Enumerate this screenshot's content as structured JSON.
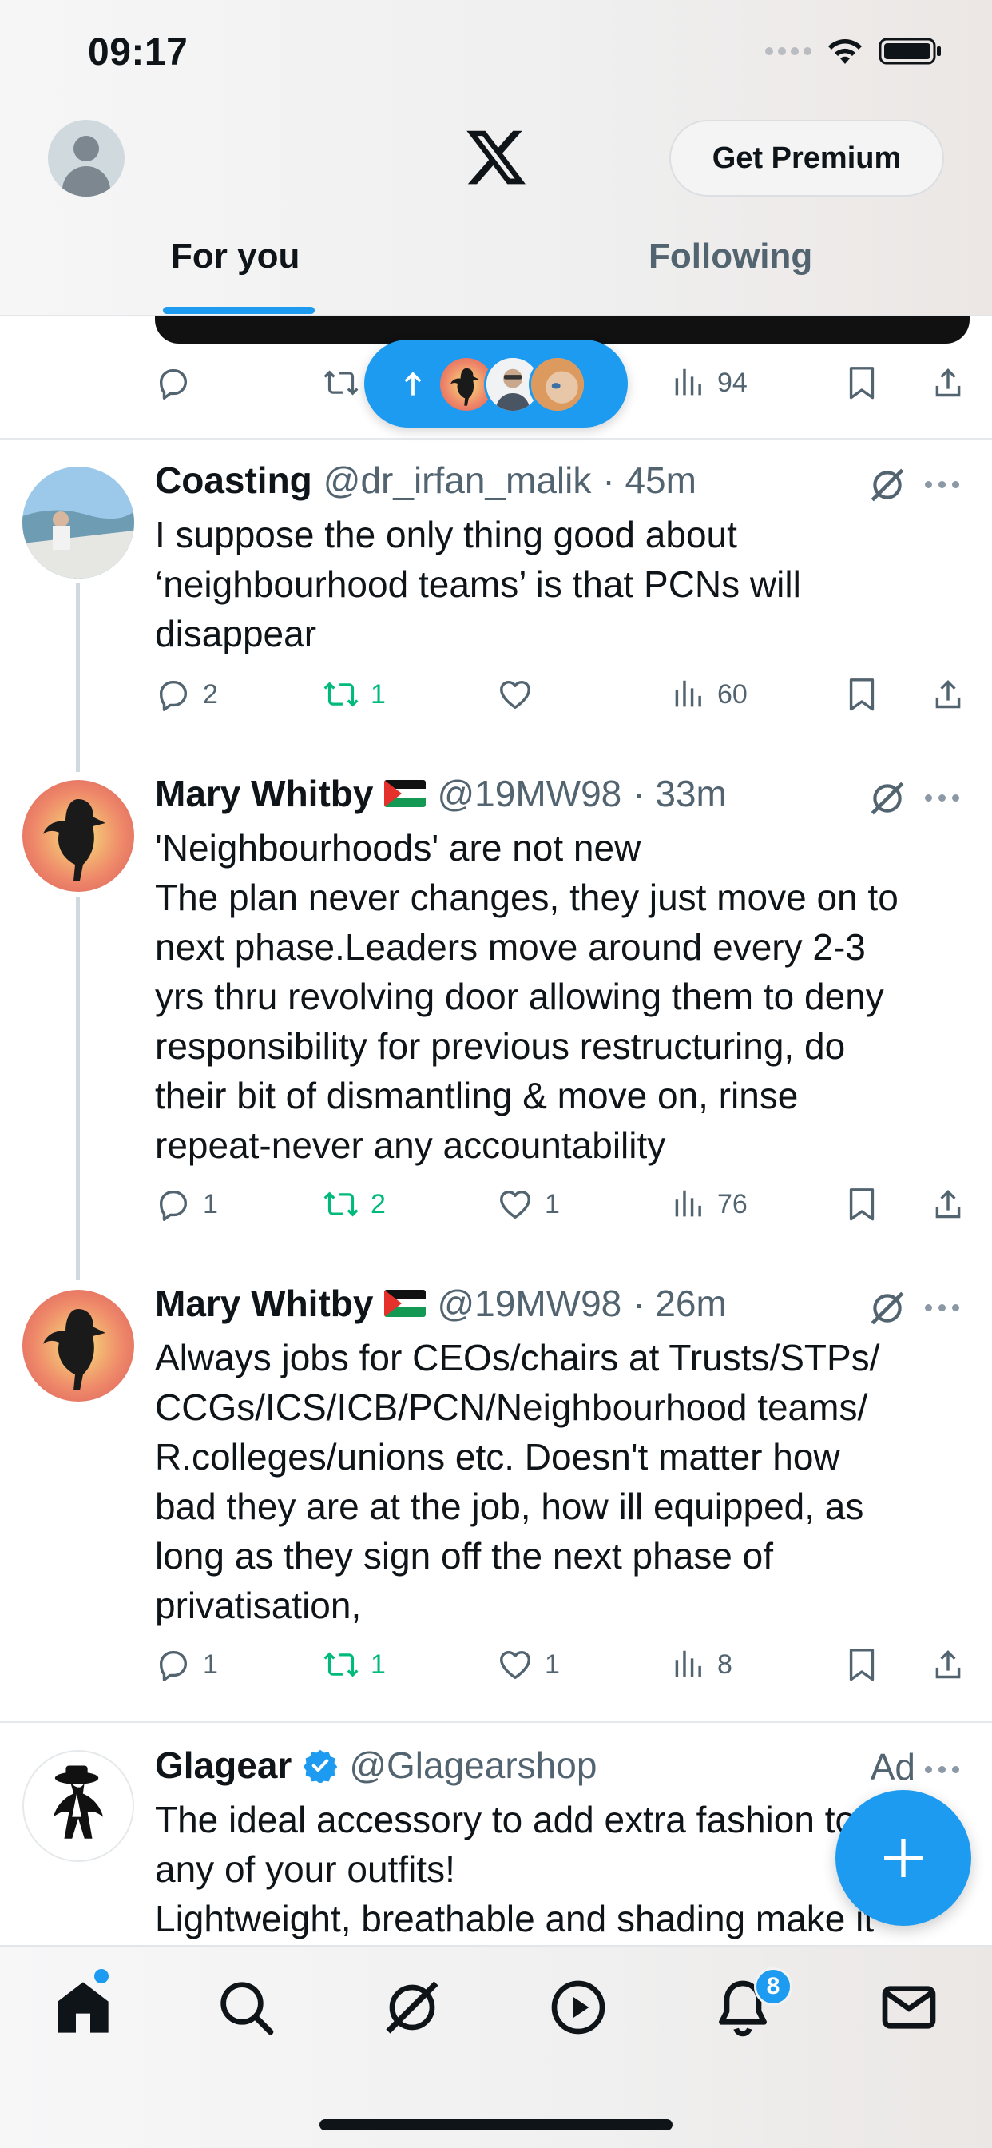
{
  "status_bar": {
    "time": "09:17"
  },
  "header": {
    "premium_label": "Get Premium",
    "tabs": [
      {
        "label": "For you",
        "active": true
      },
      {
        "label": "Following",
        "active": false
      }
    ]
  },
  "top_tweet_actions": {
    "views": "94"
  },
  "tweets": [
    {
      "name": "Coasting",
      "handle": "@dr_irfan_malik",
      "time": "· 45m",
      "text": "I suppose the only thing good about\n‘neighbourhood teams’ is that PCNs will\ndisappear",
      "replies": "2",
      "reposts": "1",
      "likes": "",
      "views": "60"
    },
    {
      "name": "Mary Whitby",
      "handle": "@19MW98",
      "time": "· 33m",
      "text": "'Neighbourhoods' are not new\nThe plan never changes, they just move on to\nnext phase.Leaders move around every 2-3\nyrs thru revolving door allowing them to deny\nresponsibility for previous restructuring, do\ntheir bit of dismantling & move on, rinse\nrepeat-never any accountability",
      "replies": "1",
      "reposts": "2",
      "likes": "1",
      "views": "76"
    },
    {
      "name": "Mary Whitby",
      "handle": "@19MW98",
      "time": "· 26m",
      "text": "Always jobs for CEOs/chairs at Trusts/STPs/\nCCGs/ICS/ICB/PCN/Neighbourhood teams/\nR.colleges/unions etc. Doesn't matter how\nbad they are at the job, how ill equipped, as\nlong as they sign off the next phase of\nprivatisation,",
      "replies": "1",
      "reposts": "1",
      "likes": "1",
      "views": "8"
    }
  ],
  "ad": {
    "name": "Glagear",
    "handle": "@Glagearshop",
    "label": "Ad",
    "text": "The ideal accessory to add extra fashion to\nany of your outfits!\nLightweight, breathable and shading make it"
  },
  "bottom_nav": {
    "items": [
      "home-icon",
      "search-icon",
      "grok-icon",
      "video-icon",
      "notifications-icon",
      "messages-icon"
    ],
    "notifications_badge": "8"
  },
  "colors": {
    "accent": "#1d9bf0",
    "repost_green": "#00ba7c",
    "secondary_text": "#536471"
  }
}
